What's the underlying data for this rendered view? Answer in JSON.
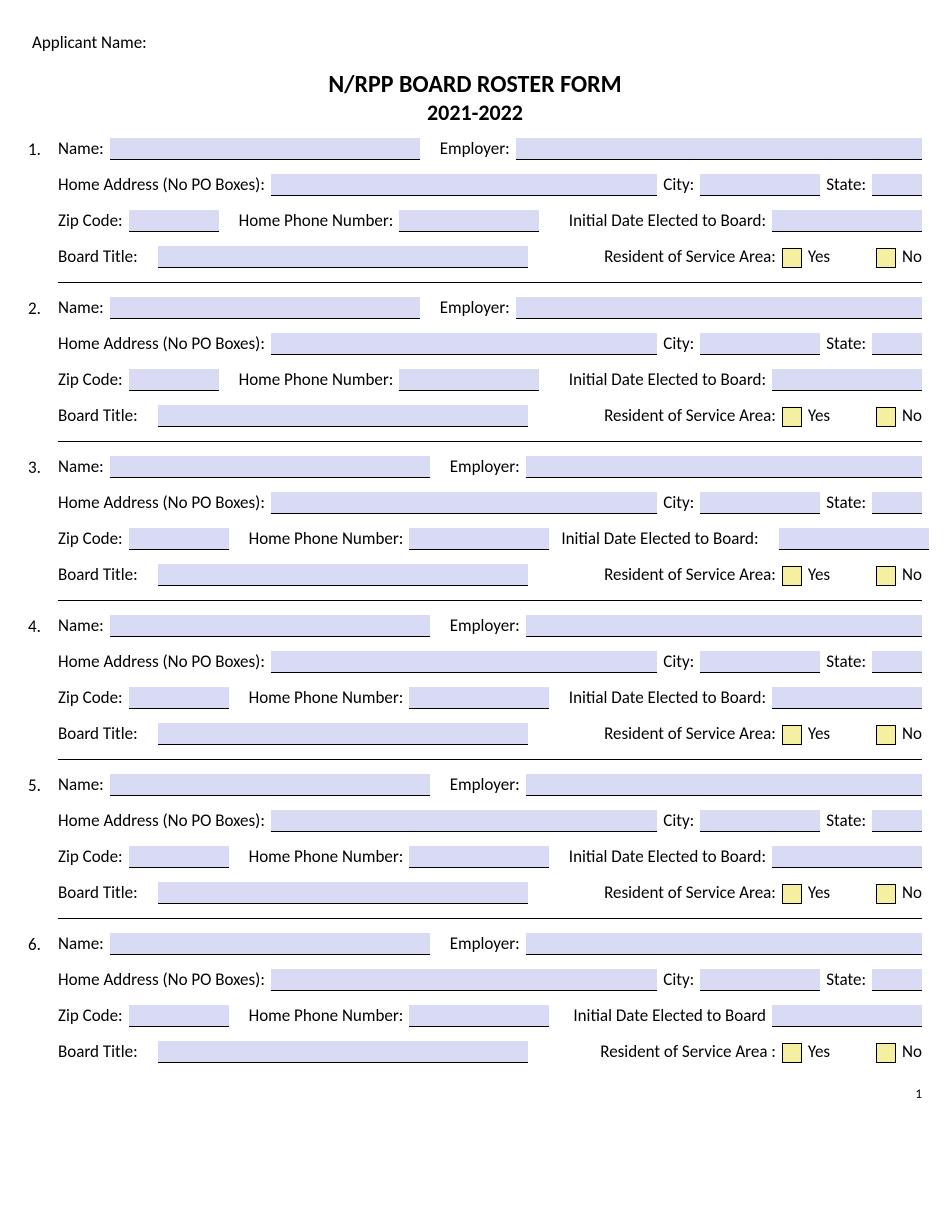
{
  "header": {
    "applicant_label": "Applicant Name:",
    "title_line1": "N/RPP BOARD ROSTER FORM",
    "title_line2": "2021-2022"
  },
  "labels": {
    "name": "Name:",
    "employer": "Employer:",
    "home_address": "Home Address (No PO Boxes):",
    "city": "City:",
    "state": "State:",
    "zip": "Zip Code:",
    "home_phone": "Home Phone Number:",
    "initial_date": "Initial Date Elected to Board:",
    "initial_date_nc": "Initial Date Elected to Board",
    "board_title": "Board Title:",
    "resident": "Resident of Service Area:",
    "resident_sp": "Resident of Service Area :",
    "yes": "Yes",
    "no": "No"
  },
  "entries": [
    {
      "num": "1."
    },
    {
      "num": "2."
    },
    {
      "num": "3."
    },
    {
      "num": "4."
    },
    {
      "num": "5."
    },
    {
      "num": "6."
    }
  ],
  "footer": {
    "page": "1"
  }
}
